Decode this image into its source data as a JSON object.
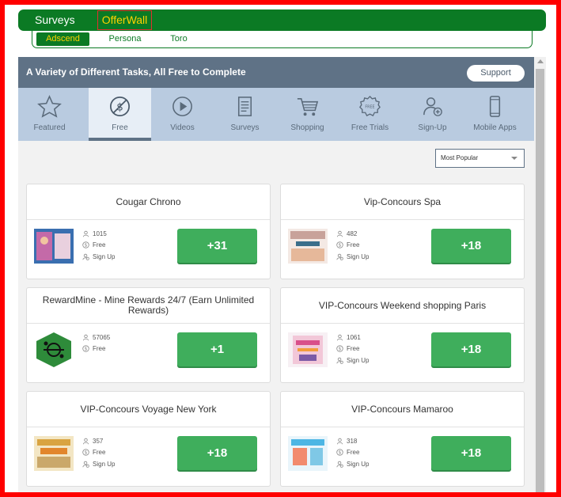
{
  "topnav": {
    "surveys_label": "Surveys",
    "offerwall_label": "OfferWall"
  },
  "subnav": {
    "items": [
      "Adscend",
      "Persona",
      "Toro"
    ]
  },
  "panel": {
    "title": "A Variety of Different Tasks, All Free to Complete",
    "support_label": "Support"
  },
  "categories": [
    {
      "label": "Featured",
      "icon": "star-icon"
    },
    {
      "label": "Free",
      "icon": "no-dollar-icon"
    },
    {
      "label": "Videos",
      "icon": "play-icon"
    },
    {
      "label": "Surveys",
      "icon": "clipboard-icon"
    },
    {
      "label": "Shopping",
      "icon": "cart-icon"
    },
    {
      "label": "Free Trials",
      "icon": "badge-icon"
    },
    {
      "label": "Sign-Up",
      "icon": "user-add-icon"
    },
    {
      "label": "Mobile Apps",
      "icon": "phone-icon"
    }
  ],
  "sort": {
    "selected": "Most Popular"
  },
  "offers": [
    {
      "title": "Cougar Chrono",
      "count": "1015",
      "free": "Free",
      "signup": "Sign Up",
      "reward": "+31"
    },
    {
      "title": "Vip-Concours Spa",
      "count": "482",
      "free": "Free",
      "signup": "Sign Up",
      "reward": "+18"
    },
    {
      "title": "RewardMine - Mine Rewards 24/7 (Earn Unlimited Rewards)",
      "count": "57065",
      "free": "Free",
      "signup": "",
      "reward": "+1"
    },
    {
      "title": "VIP-Concours Weekend shopping Paris",
      "count": "1061",
      "free": "Free",
      "signup": "Sign Up",
      "reward": "+18"
    },
    {
      "title": "VIP-Concours Voyage New York",
      "count": "357",
      "free": "Free",
      "signup": "Sign Up",
      "reward": "+18"
    },
    {
      "title": "VIP-Concours Mamaroo",
      "count": "318",
      "free": "Free",
      "signup": "Sign Up",
      "reward": "+18"
    }
  ],
  "colors": {
    "nav_green": "#0b7a24",
    "highlight_yellow": "#ffd200",
    "header_slate": "#5f7286",
    "category_bar": "#b9cbe0",
    "reward_green": "#3fae5c",
    "border_red": "#ff0000"
  }
}
